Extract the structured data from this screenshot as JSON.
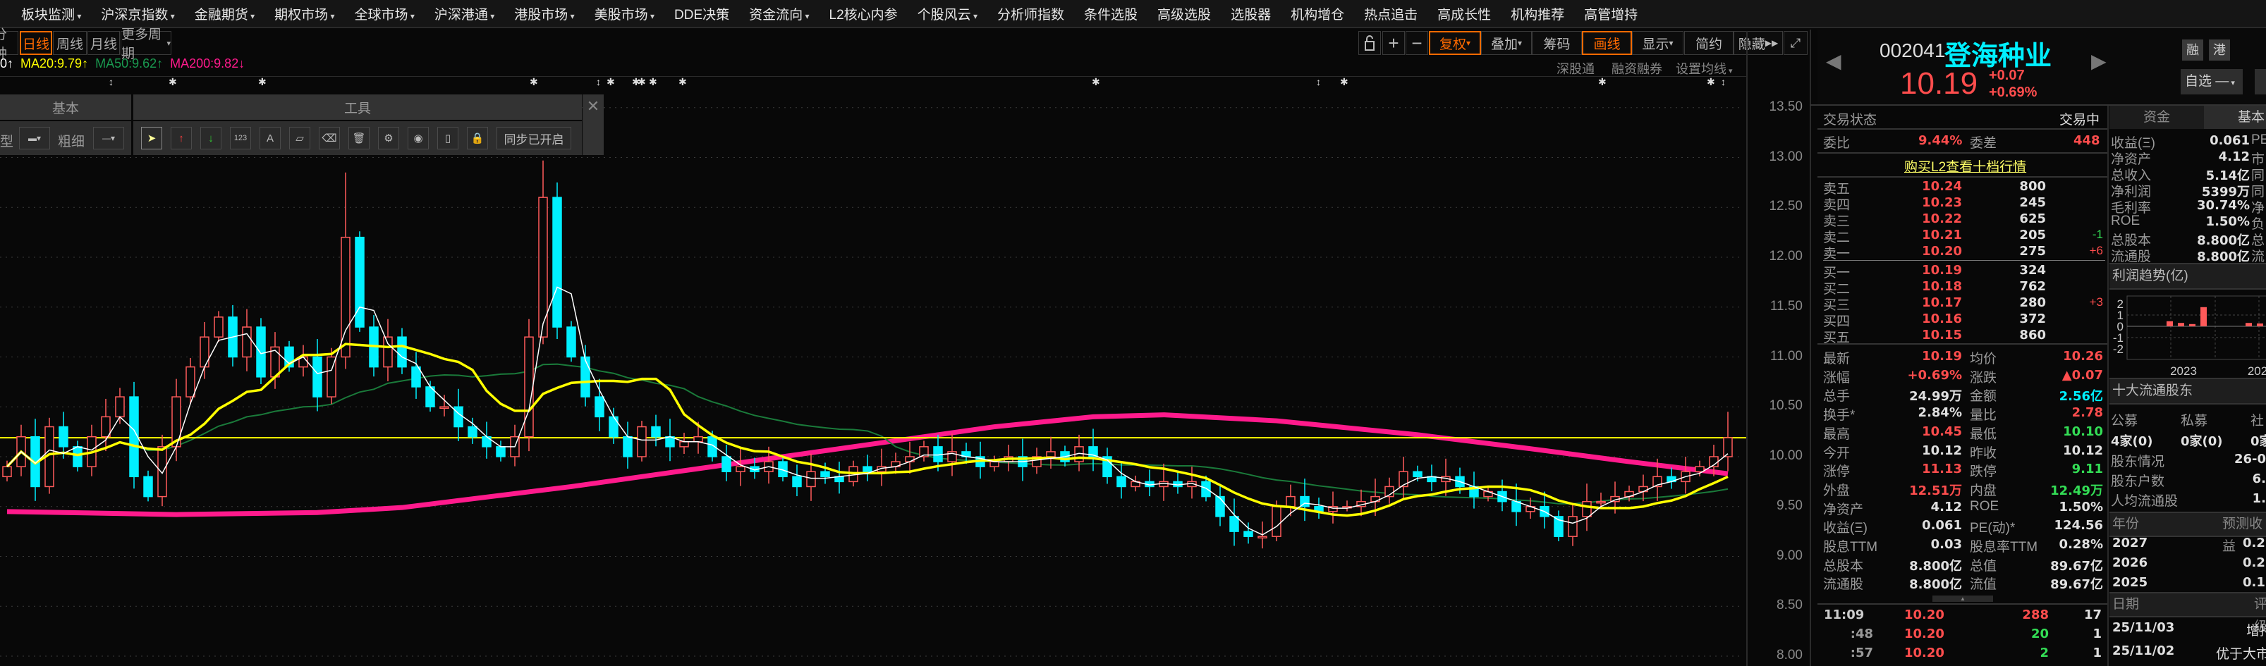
{
  "menu": [
    {
      "label": "板块监测",
      "dd": true
    },
    {
      "label": "沪深京指数",
      "dd": true
    },
    {
      "label": "金融期货",
      "dd": true
    },
    {
      "label": "期权市场",
      "dd": true
    },
    {
      "label": "全球市场",
      "dd": true
    },
    {
      "label": "沪深港通",
      "dd": true
    },
    {
      "label": "港股市场",
      "dd": true
    },
    {
      "label": "美股市场",
      "dd": true
    },
    {
      "label": "DDE决策",
      "dd": false
    },
    {
      "label": "资金流向",
      "dd": true
    },
    {
      "label": "L2核心内参",
      "dd": false
    },
    {
      "label": "个股风云",
      "dd": true
    },
    {
      "label": "分析师指数",
      "dd": false
    },
    {
      "label": "条件选股",
      "dd": false
    },
    {
      "label": "高级选股",
      "dd": false
    },
    {
      "label": "选股器",
      "dd": false
    },
    {
      "label": "机构增仓",
      "dd": false
    },
    {
      "label": "热点追击",
      "dd": false
    },
    {
      "label": "高成长性",
      "dd": false
    },
    {
      "label": "机构推荐",
      "dd": false
    },
    {
      "label": "高管增持",
      "dd": false
    }
  ],
  "periods": {
    "minute": "分钟",
    "daily": "日线",
    "weekly": "周线",
    "monthly": "月线",
    "more": "更多周期"
  },
  "toolbar": {
    "fuquan": "复权",
    "overlay": "叠加",
    "chips": "筹码",
    "draw": "画线",
    "display": "显示",
    "simple": "简约",
    "hide": "隐藏"
  },
  "sublinks": {
    "sgt": "深股通",
    "margin": "融资融券",
    "ma_settings": "设置均线"
  },
  "legend": [
    {
      "text": "0↑",
      "color": "#ffffff"
    },
    {
      "text": "MA20:9.79↑",
      "color": "#ffff00"
    },
    {
      "text": "MA50:9.62↑",
      "color": "#1a9a50"
    },
    {
      "text": "MA200:9.82↓",
      "color": "#ff1a8c"
    }
  ],
  "tool_panel": {
    "basic": "基本",
    "tools": "工具",
    "type_label": "型",
    "width_label": "粗细",
    "sync": "同步已开启",
    "counter_icon": "123",
    "text_icon": "A"
  },
  "event_markers": [
    "↕",
    "✱",
    "✱",
    "✱",
    "↕",
    "✱",
    "✱",
    "✱",
    "✱",
    "✱",
    "✱",
    "↕",
    "✱",
    "✱",
    "✱",
    "↕"
  ],
  "chart_data": {
    "type": "candlestick",
    "yticks": [
      "13.50",
      "13.00",
      "12.50",
      "12.00",
      "11.50",
      "11.00",
      "10.50",
      "10.00",
      "9.50",
      "9.00",
      "8.50",
      "8.00"
    ],
    "ylim": [
      8.0,
      13.5
    ],
    "current_price": 10.19,
    "closes": [
      9.9,
      10.2,
      9.7,
      10.3,
      10.1,
      9.9,
      10.2,
      10.4,
      10.6,
      9.8,
      9.6,
      10.1,
      10.6,
      10.9,
      11.2,
      11.4,
      11.0,
      11.3,
      10.8,
      11.1,
      10.9,
      11.0,
      10.6,
      11.0,
      12.2,
      11.3,
      10.9,
      11.2,
      10.9,
      10.7,
      10.5,
      10.5,
      10.3,
      10.2,
      10.1,
      10.0,
      10.2,
      11.2,
      12.6,
      11.3,
      11.0,
      10.6,
      10.4,
      10.2,
      10.0,
      10.3,
      10.2,
      10.1,
      10.15,
      10.2,
      10.0,
      9.85,
      9.9,
      9.85,
      9.95,
      9.8,
      9.7,
      9.85,
      9.8,
      9.75,
      9.9,
      9.85,
      9.9,
      9.95,
      10.0,
      10.1,
      9.95,
      10.05,
      10.0,
      9.9,
      9.95,
      10.0,
      9.9,
      10.0,
      10.05,
      9.95,
      10.1,
      10.0,
      9.8,
      9.7,
      9.75,
      9.7,
      9.75,
      9.7,
      9.75,
      9.6,
      9.4,
      9.25,
      9.2,
      9.2,
      9.5,
      9.6,
      9.5,
      9.45,
      9.5,
      9.5,
      9.55,
      9.6,
      9.7,
      9.85,
      9.8,
      9.75,
      9.8,
      9.7,
      9.6,
      9.65,
      9.55,
      9.45,
      9.5,
      9.4,
      9.2,
      9.4,
      9.55,
      9.55,
      9.6,
      9.65,
      9.7,
      9.8,
      9.75,
      9.85,
      9.9,
      10.0,
      10.19
    ],
    "spike_highs": {
      "24": 12.85,
      "38": 12.97,
      "122": 10.45
    },
    "ma200": [
      [
        0,
        9.45
      ],
      [
        12,
        9.42
      ],
      [
        22,
        9.44
      ],
      [
        28,
        9.49
      ],
      [
        40,
        9.7
      ],
      [
        55,
        10.0
      ],
      [
        62,
        10.14
      ],
      [
        70,
        10.3
      ],
      [
        77,
        10.4
      ],
      [
        82,
        10.42
      ],
      [
        90,
        10.36
      ],
      [
        100,
        10.22
      ],
      [
        108,
        10.08
      ],
      [
        115,
        9.95
      ],
      [
        122,
        9.83
      ]
    ]
  },
  "quote": {
    "code": "002041",
    "name": "登海种业",
    "price": "10.19",
    "change": "+0.07",
    "change_pct": "+0.69%",
    "tags": [
      "融",
      "港"
    ],
    "watchlist": "自选",
    "watch_state": "—",
    "status_label": "交易状态",
    "status_value": "交易中",
    "wb_label": "委比",
    "wb_value": "9.44%",
    "wc_label": "委差",
    "wc_value": "448",
    "l2_link": "购买L2查看十档行情"
  },
  "asks": [
    {
      "label": "卖五",
      "price": "10.24",
      "vol": "800",
      "chg": ""
    },
    {
      "label": "卖四",
      "price": "10.23",
      "vol": "245",
      "chg": ""
    },
    {
      "label": "卖三",
      "price": "10.22",
      "vol": "625",
      "chg": ""
    },
    {
      "label": "卖二",
      "price": "10.21",
      "vol": "205",
      "chg": "-1"
    },
    {
      "label": "卖一",
      "price": "10.20",
      "vol": "275",
      "chg": "+6"
    }
  ],
  "bids": [
    {
      "label": "买一",
      "price": "10.19",
      "vol": "324",
      "chg": ""
    },
    {
      "label": "买二",
      "price": "10.18",
      "vol": "762",
      "chg": ""
    },
    {
      "label": "买三",
      "price": "10.17",
      "vol": "280",
      "chg": "+3"
    },
    {
      "label": "买四",
      "price": "10.16",
      "vol": "372",
      "chg": ""
    },
    {
      "label": "买五",
      "price": "10.15",
      "vol": "860",
      "chg": ""
    }
  ],
  "stats": [
    {
      "l1": "最新",
      "v1": "10.19",
      "c1": "red",
      "l2": "均价",
      "v2": "10.26",
      "c2": "red"
    },
    {
      "l1": "涨幅",
      "v1": "+0.69%",
      "c1": "red",
      "l2": "涨跌",
      "v2": "▲0.07",
      "c2": "red"
    },
    {
      "l1": "总手",
      "v1": "24.99万",
      "c1": "white",
      "l2": "金额",
      "v2": "2.56亿",
      "c2": "cyan"
    },
    {
      "l1": "换手*",
      "v1": "2.84%",
      "c1": "white",
      "l2": "量比",
      "v2": "2.78",
      "c2": "red"
    },
    {
      "l1": "最高",
      "v1": "10.45",
      "c1": "red",
      "l2": "最低",
      "v2": "10.10",
      "c2": "green"
    },
    {
      "l1": "今开",
      "v1": "10.12",
      "c1": "white",
      "l2": "昨收",
      "v2": "10.12",
      "c2": "white"
    },
    {
      "l1": "涨停",
      "v1": "11.13",
      "c1": "red",
      "l2": "跌停",
      "v2": "9.11",
      "c2": "green"
    },
    {
      "l1": "外盘",
      "v1": "12.51万",
      "c1": "red",
      "l2": "内盘",
      "v2": "12.49万",
      "c2": "green"
    },
    {
      "l1": "净资产",
      "v1": "4.12",
      "c1": "white",
      "l2": "ROE",
      "v2": "1.50%",
      "c2": "white"
    },
    {
      "l1": "收益(Ξ)",
      "v1": "0.061",
      "c1": "white",
      "l2": "PE(动)*",
      "v2": "124.56",
      "c2": "white"
    },
    {
      "l1": "股息TTM",
      "v1": "0.03",
      "c1": "white",
      "l2": "股息率TTM",
      "v2": "0.28%",
      "c2": "white"
    },
    {
      "l1": "总股本",
      "v1": "8.800亿",
      "c1": "white",
      "l2": "总值",
      "v2": "89.67亿",
      "c2": "white"
    },
    {
      "l1": "流通股",
      "v1": "8.800亿",
      "c1": "white",
      "l2": "流值",
      "v2": "89.67亿",
      "c2": "white"
    }
  ],
  "ticks": [
    {
      "time": "11:09",
      "price": "10.20",
      "vol": "288",
      "vc": "red",
      "n": "17"
    },
    {
      "time": ":48",
      "price": "10.20",
      "vol": "20",
      "vc": "green",
      "n": "1"
    },
    {
      "time": ":57",
      "price": "10.20",
      "vol": "2",
      "vc": "green",
      "n": "1"
    }
  ],
  "side_tabs": {
    "funds": "资金",
    "basic": "基本"
  },
  "fundamentals": [
    {
      "label": "收益(Ξ)",
      "value": "0.061",
      "next": "PE"
    },
    {
      "label": "净资产",
      "value": "4.12",
      "next": "市"
    },
    {
      "label": "总收入",
      "value": "5.14亿",
      "next": "同"
    },
    {
      "label": "净利润",
      "value": "5399万",
      "next": "同"
    },
    {
      "label": "毛利率",
      "value": "30.74%",
      "next": "净"
    },
    {
      "label": "ROE",
      "value": "1.50%",
      "next": "负"
    },
    {
      "label": "总股本",
      "value": "8.800亿",
      "next": "总"
    },
    {
      "label": "流通股",
      "value": "8.800亿",
      "next": "流"
    }
  ],
  "profit_trend": {
    "title": "利润趋势(亿)",
    "yticks": [
      "2",
      "1",
      "0",
      "-1",
      "-2"
    ],
    "xticks": [
      "2023",
      "202"
    ],
    "bars": [
      [
        3,
        0.45
      ],
      [
        4,
        0.3
      ],
      [
        5,
        0.2
      ],
      [
        6,
        1.7
      ],
      [
        10,
        0.3
      ],
      [
        11,
        0.25
      ],
      [
        12,
        0.05
      ]
    ],
    "bar_color": "#ff5a5a"
  },
  "holders": {
    "title": "十大流通股东",
    "cols": [
      "公募",
      "私募",
      "社"
    ],
    "vals": [
      "4家(0)",
      "0家(0)",
      "0家"
    ],
    "rows": [
      {
        "label": "股东情况",
        "value": "26-0"
      },
      {
        "label": "股东户数",
        "value": "6."
      },
      {
        "label": "人均流通股",
        "value": "1."
      }
    ]
  },
  "forecast": {
    "h1": "年份",
    "h2": "预测收益",
    "rows": [
      {
        "year": "2027",
        "value": "0.2"
      },
      {
        "year": "2026",
        "value": "0.2"
      },
      {
        "year": "2025",
        "value": "0.1"
      }
    ]
  },
  "ratings": {
    "h1": "日期",
    "h2": "评级",
    "rows": [
      {
        "date": "25/11/03",
        "value": "增持"
      },
      {
        "date": "25/11/02",
        "value": "优于大市"
      }
    ]
  }
}
